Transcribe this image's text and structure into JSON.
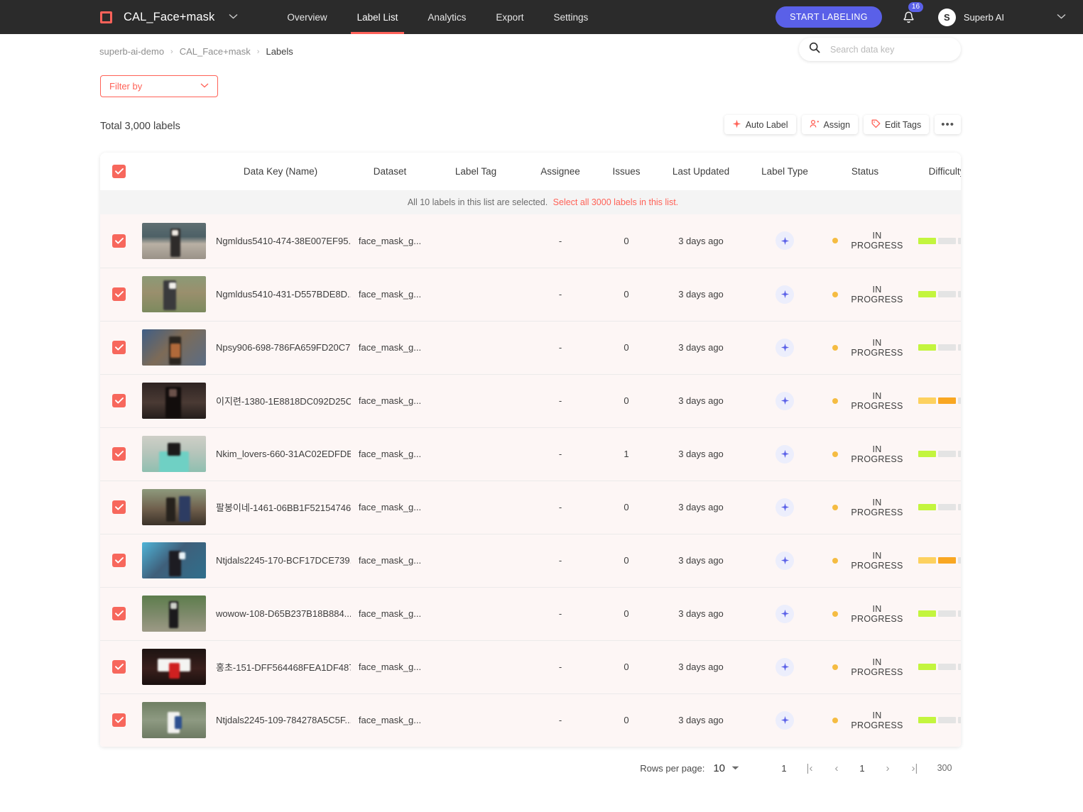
{
  "topbar": {
    "logo_icon": "square-logo-icon",
    "project_name": "CAL_Face+mask",
    "project_caret": "⌄",
    "nav": [
      {
        "label": "Overview",
        "active": false
      },
      {
        "label": "Label List",
        "active": true
      },
      {
        "label": "Analytics",
        "active": false
      },
      {
        "label": "Export",
        "active": false
      },
      {
        "label": "Settings",
        "active": false
      }
    ],
    "start_labeling": "START LABELING",
    "notification_count": "16",
    "avatar_initial": "S",
    "user_name": "Superb AI",
    "user_caret": "⌄",
    "accent_color": "#ff625a",
    "primary_color": "#5a60e8"
  },
  "breadcrumb": {
    "items": [
      "superb-ai-demo",
      "CAL_Face+mask",
      "Labels"
    ],
    "separator": "›"
  },
  "search": {
    "placeholder": "Search data key",
    "value": "",
    "icon": "search-icon"
  },
  "filter": {
    "label": "Filter by",
    "caret": "⌄"
  },
  "toolbar": {
    "total_label": "Total 3,000 labels",
    "auto_label": "Auto Label",
    "assign": "Assign",
    "edit_tags": "Edit Tags",
    "more": "•••"
  },
  "table": {
    "columns": [
      "Data Key (Name)",
      "Dataset",
      "Label Tag",
      "Assignee",
      "Issues",
      "Last Updated",
      "Label Type",
      "Status",
      "Difficulty"
    ],
    "select_notice": "All 10 labels in this list are selected.",
    "select_all_link": "Select all 3000 labels in this list.",
    "rows": [
      {
        "data_key": "Ngmldus5410-474-38E007EF95...",
        "dataset": "face_mask_g...",
        "label_tag": "",
        "assignee": "-",
        "issues": "0",
        "last_updated": "3 days ago",
        "label_type": "auto-label-icon",
        "status": "IN PROGRESS",
        "difficulty": 1,
        "thumb": "street-person-white-mask"
      },
      {
        "data_key": "Ngmldus5410-431-D557BDE8D...",
        "dataset": "face_mask_g...",
        "label_tag": "",
        "assignee": "-",
        "issues": "0",
        "last_updated": "3 days ago",
        "label_type": "auto-label-icon",
        "status": "IN PROGRESS",
        "difficulty": 1,
        "thumb": "park-person-white-mask"
      },
      {
        "data_key": "Npsy906-698-786FA659FD20C7...",
        "dataset": "face_mask_g...",
        "label_tag": "",
        "assignee": "-",
        "issues": "0",
        "last_updated": "3 days ago",
        "label_type": "auto-label-icon",
        "status": "IN PROGRESS",
        "difficulty": 1,
        "thumb": "shop-front-person"
      },
      {
        "data_key": "이지련-1380-1E8818DC092D25C...",
        "dataset": "face_mask_g...",
        "label_tag": "",
        "assignee": "-",
        "issues": "0",
        "last_updated": "3 days ago",
        "label_type": "auto-label-icon",
        "status": "IN PROGRESS",
        "difficulty": 2,
        "thumb": "dark-indoor-person"
      },
      {
        "data_key": "Nkim_lovers-660-31AC02EDFDE...",
        "dataset": "face_mask_g...",
        "label_tag": "",
        "assignee": "-",
        "issues": "1",
        "last_updated": "3 days ago",
        "label_type": "auto-label-icon",
        "status": "IN PROGRESS",
        "difficulty": 1,
        "thumb": "portrait-black-mask"
      },
      {
        "data_key": "팔봉이네-1461-06BB1F52154746...",
        "dataset": "face_mask_g...",
        "label_tag": "",
        "assignee": "-",
        "issues": "0",
        "last_updated": "3 days ago",
        "label_type": "auto-label-icon",
        "status": "IN PROGRESS",
        "difficulty": 1,
        "thumb": "two-people-outside-house"
      },
      {
        "data_key": "Ntjdals2245-170-BCF17DCE739...",
        "dataset": "face_mask_g...",
        "label_tag": "",
        "assignee": "-",
        "issues": "0",
        "last_updated": "3 days ago",
        "label_type": "auto-label-icon",
        "status": "IN PROGRESS",
        "difficulty": 2,
        "thumb": "street-banner-person"
      },
      {
        "data_key": "wowow-108-D65B237B18B884...",
        "dataset": "face_mask_g...",
        "label_tag": "",
        "assignee": "-",
        "issues": "0",
        "last_updated": "3 days ago",
        "label_type": "auto-label-icon",
        "status": "IN PROGRESS",
        "difficulty": 1,
        "thumb": "tree-lined-path-person"
      },
      {
        "data_key": "홍초-151-DFF564468FEA1DF487...",
        "dataset": "face_mask_g...",
        "label_tag": "",
        "assignee": "-",
        "issues": "0",
        "last_updated": "3 days ago",
        "label_type": "auto-label-icon",
        "status": "IN PROGRESS",
        "difficulty": 1,
        "thumb": "night-angel-wings-red-jacket"
      },
      {
        "data_key": "Ntjdals2245-109-784278A5C5F...",
        "dataset": "face_mask_g...",
        "label_tag": "",
        "assignee": "-",
        "issues": "0",
        "last_updated": "3 days ago",
        "label_type": "auto-label-icon",
        "status": "IN PROGRESS",
        "difficulty": 1,
        "thumb": "street-white-shirt-backpack"
      }
    ]
  },
  "pagination": {
    "rows_per_page_label": "Rows per page:",
    "rows_per_page_value": "10",
    "caret": "▾",
    "current_start": "1",
    "first": "|‹",
    "prev": "‹",
    "page": "1",
    "next": "›",
    "last": "›|",
    "total": "300"
  },
  "colors": {
    "difficulty_easy": "#c3f53e",
    "difficulty_mid_light": "#fdd15f",
    "difficulty_mid": "#f9a722",
    "difficulty_empty": "#e4e4e4",
    "status_dot": "#f5bc42",
    "row_bg": "#fdf6f5"
  }
}
